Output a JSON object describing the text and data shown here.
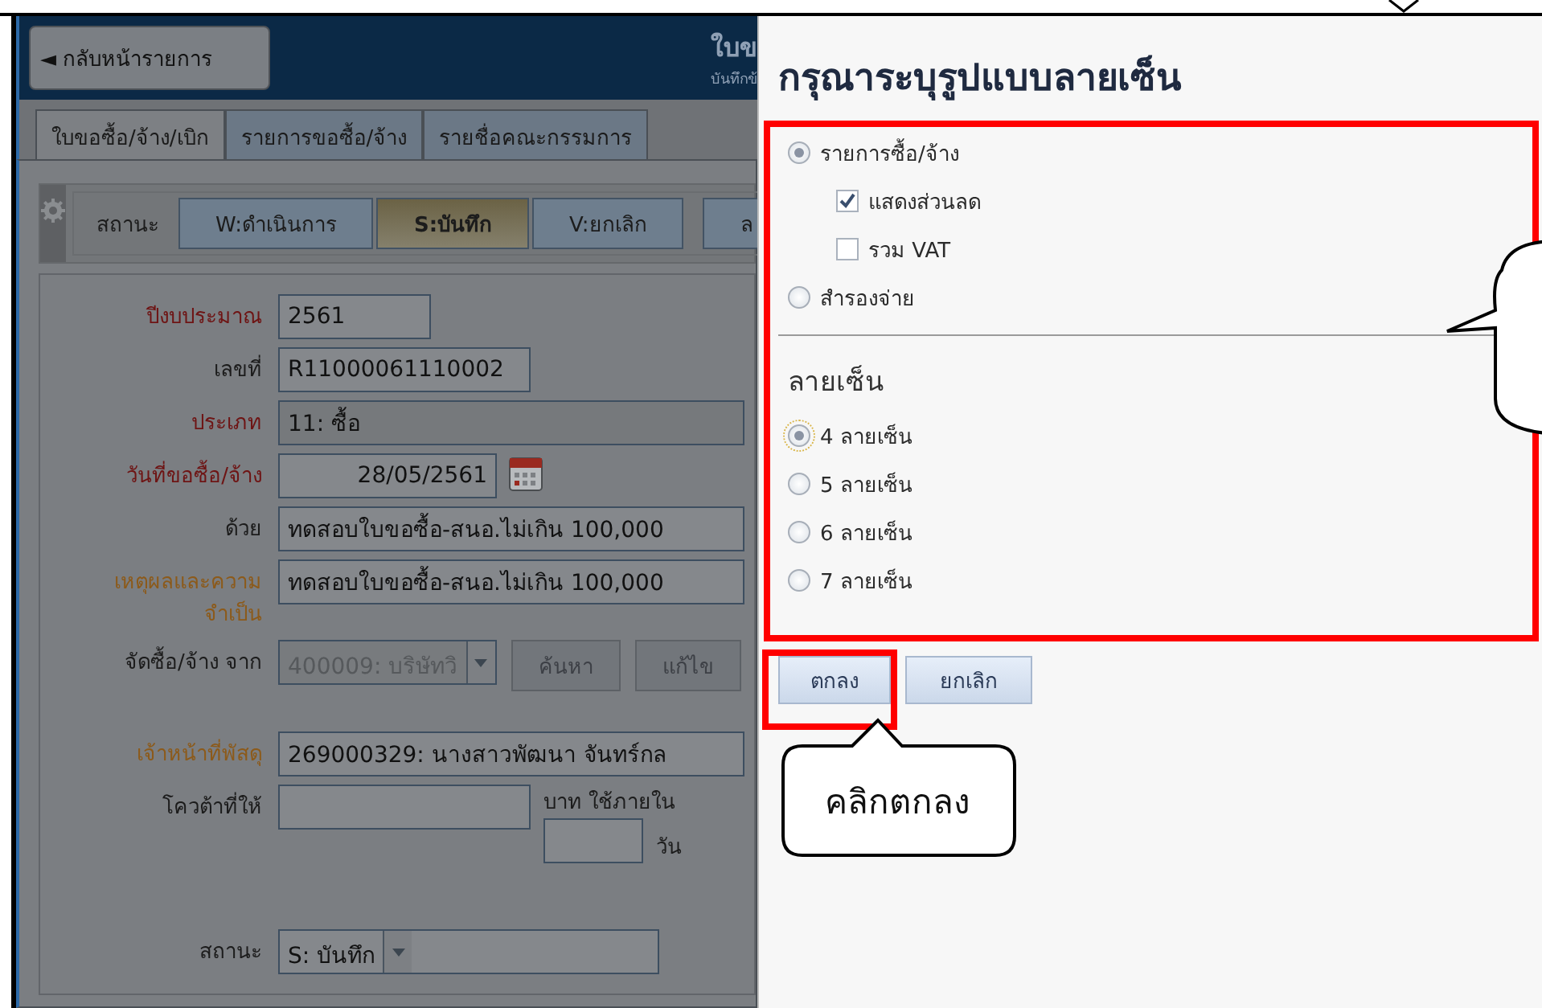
{
  "header": {
    "back_button": "◄ กลับหน้ารายการ",
    "title": "ใบข",
    "subtitle": "บันทึกข้"
  },
  "tabs": [
    {
      "label": "ใบขอซื้อ/จ้าง/เบิก",
      "selected": true
    },
    {
      "label": "รายการขอซื้อ/จ้าง",
      "selected": false
    },
    {
      "label": "รายชื่อคณะกรรมการ",
      "selected": false
    }
  ],
  "status_toolbar": {
    "label": "สถานะ",
    "buttons": [
      {
        "label": "W:ดำเนินการ",
        "selected": false
      },
      {
        "label": "S:บันทึก",
        "selected": true
      },
      {
        "label": "V:ยกเลิก",
        "selected": false
      },
      {
        "label": "ล",
        "selected": false
      }
    ]
  },
  "form": {
    "rows": [
      {
        "kind": "short",
        "label": "ปีงบประมาณ",
        "color": "#6e1414",
        "value": "2561",
        "disabled": false
      },
      {
        "kind": "medium",
        "label": "เลขที่",
        "color": "#1c1c1c",
        "value": "R11000061110002",
        "disabled": false
      },
      {
        "kind": "wide",
        "label": "ประเภท",
        "color": "#6e1414",
        "value": "11: ซื้อ",
        "disabled": true
      },
      {
        "kind": "date",
        "label": "วันที่ขอซื้อ/จ้าง",
        "color": "#6e1414",
        "value": "28/05/2561",
        "disabled": false
      },
      {
        "kind": "wide",
        "label": "ด้วย",
        "color": "#1c1c1c",
        "value": "ทดสอบใบขอซื้อ-สนอ.ไม่เกิน 100,000",
        "disabled": false
      },
      {
        "kind": "wide",
        "label": "เหตุผลและความจำเป็น",
        "color": "#8c5a1a",
        "value": "ทดสอบใบขอซื้อ-สนอ.ไม่เกิน 100,000",
        "disabled": false
      },
      {
        "kind": "supplier",
        "label": "จัดซื้อ/จ้าง จาก",
        "color": "#1c1c1c",
        "value": "400009: บริษัทวิ",
        "disabled": true,
        "buttons": [
          "ค้นหา",
          "แก้ไข"
        ]
      },
      {
        "kind": "wide",
        "label": "เจ้าหน้าที่พัสดุ",
        "color": "#8c5a1a",
        "value": "269000329: นางสาวพัฒนา จันทร์กล",
        "disabled": false
      },
      {
        "kind": "quota",
        "label": "โควต้าที่ให้",
        "color": "#1c1c1c",
        "unit": "บาท ใช้ภายใน",
        "days_unit": "วัน",
        "disabled": false
      },
      {
        "kind": "select",
        "label": "สถานะ",
        "color": "#1c1c1c",
        "value": "S: บันทึก",
        "disabled": false
      }
    ]
  },
  "dialog": {
    "title": "กรุณาระบุรูปแบบลายเซ็น",
    "format_options": [
      {
        "label": "รายการซื้อ/จ้าง",
        "selected": true,
        "children": [
          {
            "label": "แสดงส่วนลด",
            "checked": true
          },
          {
            "label": "รวม VAT",
            "checked": false
          }
        ]
      },
      {
        "label": "สำรองจ่าย",
        "selected": false
      }
    ],
    "signature_heading": "ลายเซ็น",
    "signature_options": [
      {
        "label": "4 ลายเซ็น",
        "selected": true
      },
      {
        "label": "5 ลายเซ็น",
        "selected": false
      },
      {
        "label": "6 ลายเซ็น",
        "selected": false
      },
      {
        "label": "7 ลายเซ็น",
        "selected": false
      }
    ],
    "buttons": [
      "ตกลง",
      "ยกเลิก"
    ]
  },
  "annotation": {
    "callout_text": "คลิกตกลง"
  }
}
